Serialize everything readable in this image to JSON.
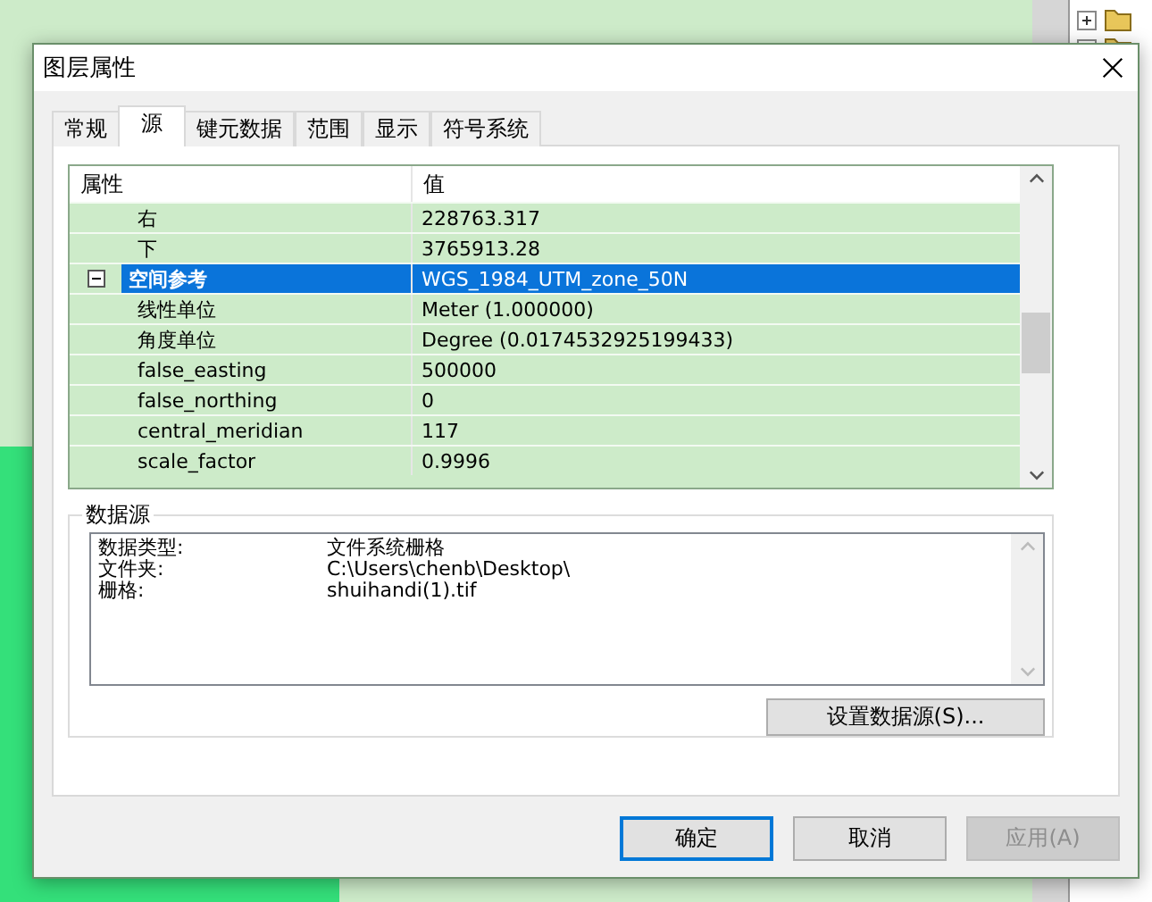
{
  "window": {
    "title": "图层属性"
  },
  "tabs": [
    {
      "label": "常规",
      "selected": false
    },
    {
      "label": "源",
      "selected": true
    },
    {
      "label": "键元数据",
      "selected": false
    },
    {
      "label": "范围",
      "selected": false
    },
    {
      "label": "显示",
      "selected": false
    },
    {
      "label": "符号系统",
      "selected": false
    }
  ],
  "property_grid": {
    "columns": [
      "属性",
      "值"
    ],
    "rows": [
      {
        "name": "右",
        "value": "228763.317",
        "selected": false
      },
      {
        "name": "下",
        "value": "3765913.28",
        "selected": false
      },
      {
        "name": "空间参考",
        "value": "WGS_1984_UTM_zone_50N",
        "selected": true,
        "expanded": true,
        "children": [
          {
            "name": "线性单位",
            "value": "Meter (1.000000)",
            "selected": false
          },
          {
            "name": "角度单位",
            "value": "Degree (0.0174532925199433)",
            "selected": false
          },
          {
            "name": "false_easting",
            "value": "500000",
            "selected": false
          },
          {
            "name": "false_northing",
            "value": "0",
            "selected": false
          },
          {
            "name": "central_meridian",
            "value": "117",
            "selected": false
          },
          {
            "name": "scale_factor",
            "value": "0.9996",
            "selected": false
          }
        ]
      }
    ]
  },
  "data_source": {
    "title": "数据源",
    "entries": [
      {
        "label": "数据类型:",
        "value": "文件系统栅格"
      },
      {
        "label": "文件夹:",
        "value": "C:\\Users\\chenb\\Desktop\\"
      },
      {
        "label": "栅格:",
        "value": "shuihandi(1).tif"
      }
    ],
    "button": "设置数据源(S)..."
  },
  "buttons": [
    {
      "label": "确定",
      "disabled": false,
      "default": true
    },
    {
      "label": "取消",
      "disabled": false,
      "default": false
    },
    {
      "label": "应用(A)",
      "disabled": true,
      "default": false
    }
  ]
}
